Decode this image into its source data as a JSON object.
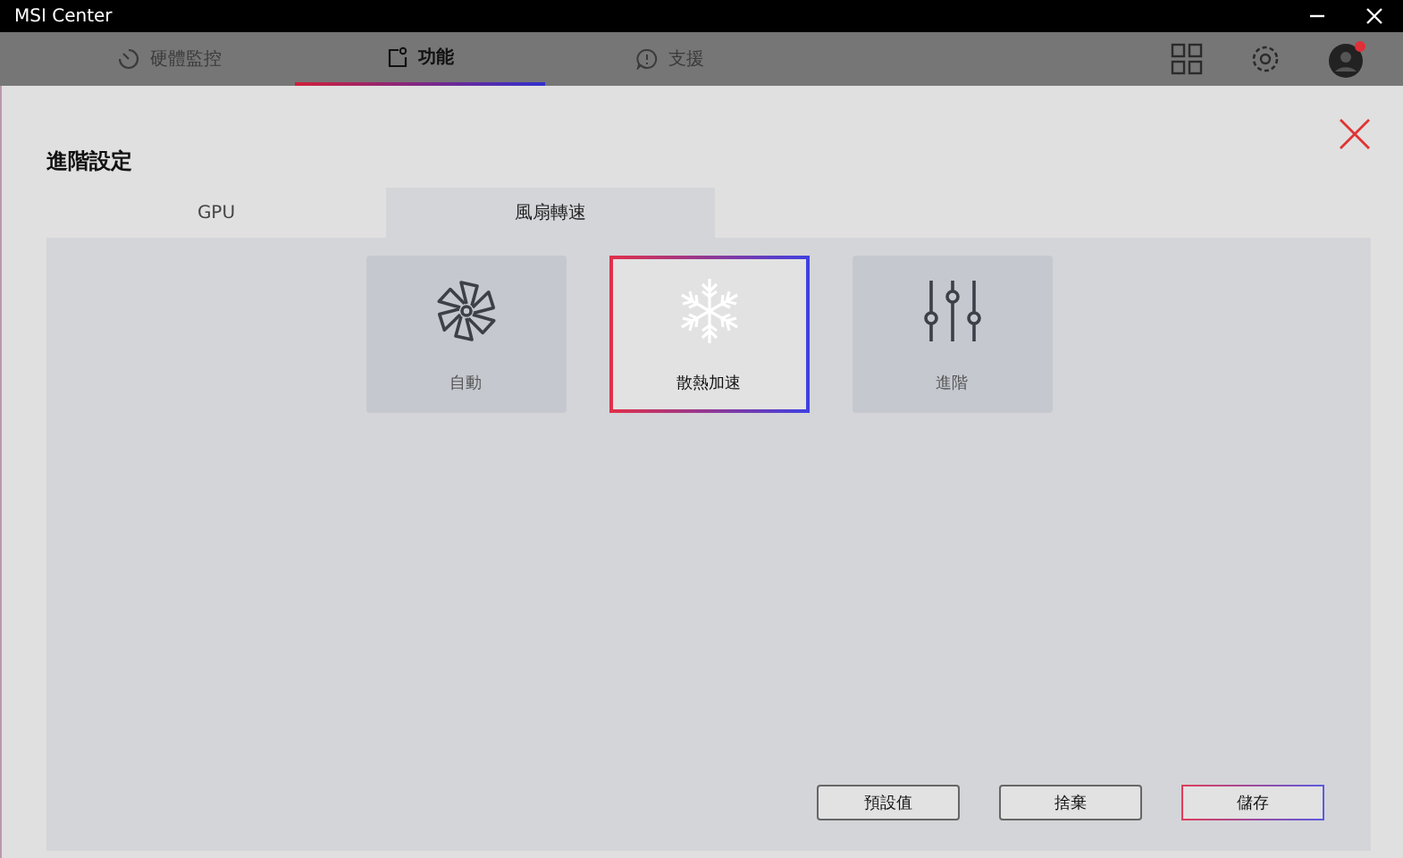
{
  "window": {
    "title": "MSI Center"
  },
  "nav_tabs": [
    {
      "label": "硬體監控",
      "kind": "gauge",
      "selected": false
    },
    {
      "label": "功能",
      "kind": "feature",
      "selected": true
    },
    {
      "label": "支援",
      "kind": "support",
      "selected": false
    }
  ],
  "dialog": {
    "title": "進階設定",
    "tabs": [
      {
        "label": "GPU",
        "selected": false
      },
      {
        "label": "風扇轉速",
        "selected": true
      }
    ],
    "modes": [
      {
        "label": "自動",
        "kind": "fan",
        "selected": false
      },
      {
        "label": "散熱加速",
        "kind": "snowflake",
        "selected": true
      },
      {
        "label": "進階",
        "kind": "sliders",
        "selected": false
      }
    ],
    "buttons": [
      {
        "label": "預設值",
        "primary": false
      },
      {
        "label": "捨棄",
        "primary": false
      },
      {
        "label": "儲存",
        "primary": true
      }
    ]
  }
}
